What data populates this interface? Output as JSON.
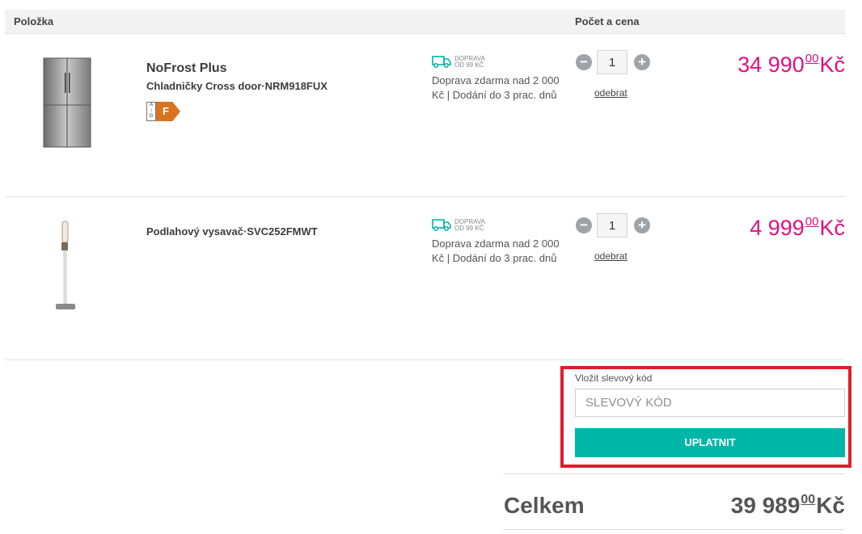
{
  "header": {
    "item_col": "Položka",
    "qty_price_col": "Počet a cena"
  },
  "items": [
    {
      "name": "NoFrost Plus",
      "subtitle": "Chladničky Cross door·NRM918FUX",
      "energy_class": "F",
      "energy_scale": "A\n↕\nG",
      "thumbnail_icon": "fridge-image",
      "shipping_badge_line1": "DOPRAVA",
      "shipping_badge_line2": "OD 99 KČ",
      "shipping_text": "Doprava zdarma nad 2 000 Kč | Dodání do 3 prac. dnů",
      "quantity": "1",
      "remove_label": "odebrat",
      "price_main": "34 990",
      "price_cents": "00",
      "currency": "Kč"
    },
    {
      "name": "",
      "subtitle": "Podlahový vysavač·SVC252FMWT",
      "thumbnail_icon": "vacuum-image",
      "shipping_badge_line1": "DOPRAVA",
      "shipping_badge_line2": "OD 99 KČ",
      "shipping_text": "Doprava zdarma nad 2 000 Kč | Dodání do 3 prac. dnů",
      "quantity": "1",
      "remove_label": "odebrat",
      "price_main": "4 999",
      "price_cents": "00",
      "currency": "Kč"
    }
  ],
  "promo": {
    "label": "Vložit slevový kód",
    "placeholder": "SLEVOVÝ KÓD",
    "button": "UPLATNIT"
  },
  "total": {
    "label": "Celkem",
    "price_main": "39 989",
    "price_cents": "00",
    "currency": "Kč"
  },
  "colors": {
    "price": "#e0117f",
    "accent": "#00b6a7",
    "highlight": "#e21b2a",
    "energy_f": "#d9731f"
  }
}
